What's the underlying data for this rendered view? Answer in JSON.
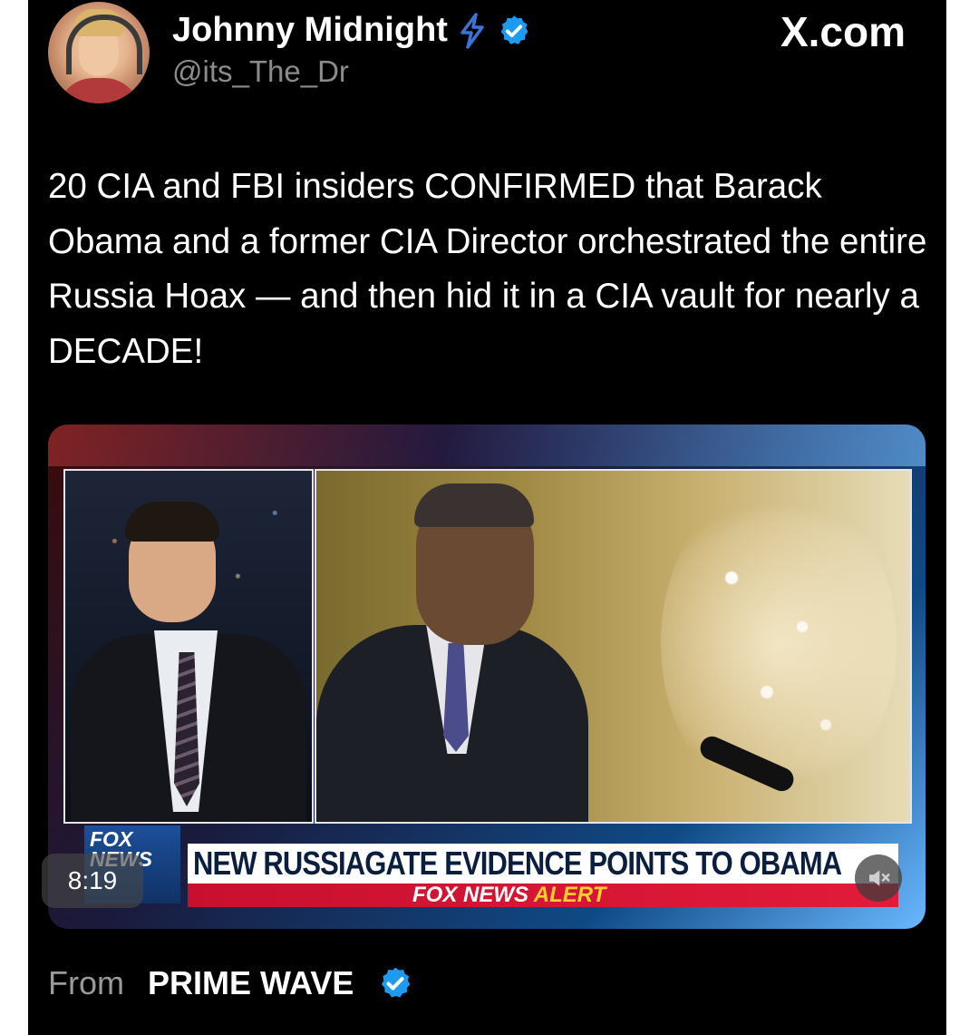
{
  "author": {
    "name": "Johnny Midnight",
    "handle": "@its_The_Dr",
    "verified": true,
    "badge_icon": "lightning-icon"
  },
  "platform": {
    "label": "X.com"
  },
  "tweet": {
    "text": "20 CIA and FBI insiders CONFIRMED that Barack Obama and a former CIA Director orchestrated the entire Russia Hoax — and then hid it in a CIA vault for nearly a DECADE!"
  },
  "video": {
    "timestamp": "8:19",
    "mute_icon": "speaker-muted-icon",
    "network_logo": "FOX NEWS",
    "chyron_headline": "NEW RUSSIAGATE EVIDENCE POINTS TO OBAMA",
    "alert_prefix": "FOX NEWS",
    "alert_word": "ALERT"
  },
  "source": {
    "from_label": "From",
    "name": "PRIME WAVE",
    "verified": true
  },
  "colors": {
    "background": "#000000",
    "text": "#ffffff",
    "muted_text": "#8b8b8b",
    "verified_blue": "#1d9bf0",
    "lightning": "#3b74d6",
    "fox_blue": "#103266",
    "alert_red": "#e21b3a"
  }
}
